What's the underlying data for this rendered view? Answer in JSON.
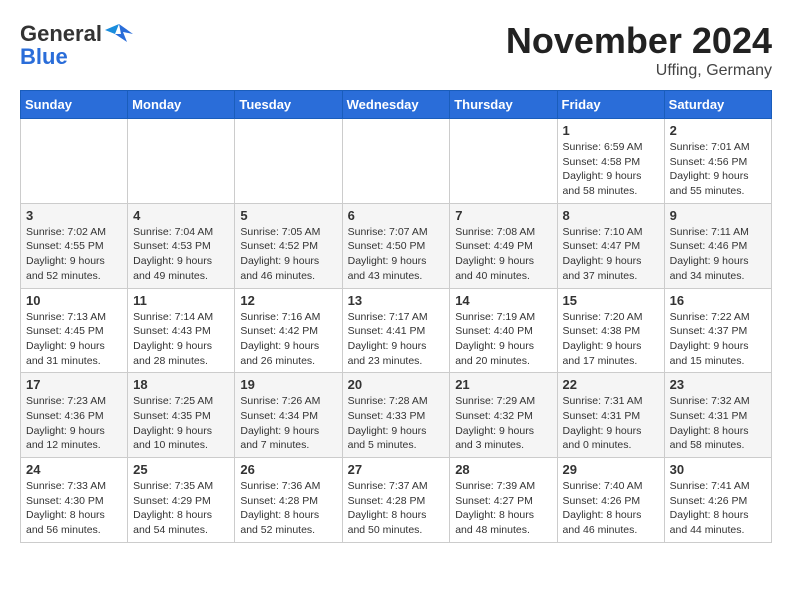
{
  "header": {
    "logo_general": "General",
    "logo_blue": "Blue",
    "month_title": "November 2024",
    "location": "Uffing, Germany"
  },
  "days_of_week": [
    "Sunday",
    "Monday",
    "Tuesday",
    "Wednesday",
    "Thursday",
    "Friday",
    "Saturday"
  ],
  "weeks": [
    [
      {
        "day": "",
        "detail": ""
      },
      {
        "day": "",
        "detail": ""
      },
      {
        "day": "",
        "detail": ""
      },
      {
        "day": "",
        "detail": ""
      },
      {
        "day": "",
        "detail": ""
      },
      {
        "day": "1",
        "detail": "Sunrise: 6:59 AM\nSunset: 4:58 PM\nDaylight: 9 hours\nand 58 minutes."
      },
      {
        "day": "2",
        "detail": "Sunrise: 7:01 AM\nSunset: 4:56 PM\nDaylight: 9 hours\nand 55 minutes."
      }
    ],
    [
      {
        "day": "3",
        "detail": "Sunrise: 7:02 AM\nSunset: 4:55 PM\nDaylight: 9 hours\nand 52 minutes."
      },
      {
        "day": "4",
        "detail": "Sunrise: 7:04 AM\nSunset: 4:53 PM\nDaylight: 9 hours\nand 49 minutes."
      },
      {
        "day": "5",
        "detail": "Sunrise: 7:05 AM\nSunset: 4:52 PM\nDaylight: 9 hours\nand 46 minutes."
      },
      {
        "day": "6",
        "detail": "Sunrise: 7:07 AM\nSunset: 4:50 PM\nDaylight: 9 hours\nand 43 minutes."
      },
      {
        "day": "7",
        "detail": "Sunrise: 7:08 AM\nSunset: 4:49 PM\nDaylight: 9 hours\nand 40 minutes."
      },
      {
        "day": "8",
        "detail": "Sunrise: 7:10 AM\nSunset: 4:47 PM\nDaylight: 9 hours\nand 37 minutes."
      },
      {
        "day": "9",
        "detail": "Sunrise: 7:11 AM\nSunset: 4:46 PM\nDaylight: 9 hours\nand 34 minutes."
      }
    ],
    [
      {
        "day": "10",
        "detail": "Sunrise: 7:13 AM\nSunset: 4:45 PM\nDaylight: 9 hours\nand 31 minutes."
      },
      {
        "day": "11",
        "detail": "Sunrise: 7:14 AM\nSunset: 4:43 PM\nDaylight: 9 hours\nand 28 minutes."
      },
      {
        "day": "12",
        "detail": "Sunrise: 7:16 AM\nSunset: 4:42 PM\nDaylight: 9 hours\nand 26 minutes."
      },
      {
        "day": "13",
        "detail": "Sunrise: 7:17 AM\nSunset: 4:41 PM\nDaylight: 9 hours\nand 23 minutes."
      },
      {
        "day": "14",
        "detail": "Sunrise: 7:19 AM\nSunset: 4:40 PM\nDaylight: 9 hours\nand 20 minutes."
      },
      {
        "day": "15",
        "detail": "Sunrise: 7:20 AM\nSunset: 4:38 PM\nDaylight: 9 hours\nand 17 minutes."
      },
      {
        "day": "16",
        "detail": "Sunrise: 7:22 AM\nSunset: 4:37 PM\nDaylight: 9 hours\nand 15 minutes."
      }
    ],
    [
      {
        "day": "17",
        "detail": "Sunrise: 7:23 AM\nSunset: 4:36 PM\nDaylight: 9 hours\nand 12 minutes."
      },
      {
        "day": "18",
        "detail": "Sunrise: 7:25 AM\nSunset: 4:35 PM\nDaylight: 9 hours\nand 10 minutes."
      },
      {
        "day": "19",
        "detail": "Sunrise: 7:26 AM\nSunset: 4:34 PM\nDaylight: 9 hours\nand 7 minutes."
      },
      {
        "day": "20",
        "detail": "Sunrise: 7:28 AM\nSunset: 4:33 PM\nDaylight: 9 hours\nand 5 minutes."
      },
      {
        "day": "21",
        "detail": "Sunrise: 7:29 AM\nSunset: 4:32 PM\nDaylight: 9 hours\nand 3 minutes."
      },
      {
        "day": "22",
        "detail": "Sunrise: 7:31 AM\nSunset: 4:31 PM\nDaylight: 9 hours\nand 0 minutes."
      },
      {
        "day": "23",
        "detail": "Sunrise: 7:32 AM\nSunset: 4:31 PM\nDaylight: 8 hours\nand 58 minutes."
      }
    ],
    [
      {
        "day": "24",
        "detail": "Sunrise: 7:33 AM\nSunset: 4:30 PM\nDaylight: 8 hours\nand 56 minutes."
      },
      {
        "day": "25",
        "detail": "Sunrise: 7:35 AM\nSunset: 4:29 PM\nDaylight: 8 hours\nand 54 minutes."
      },
      {
        "day": "26",
        "detail": "Sunrise: 7:36 AM\nSunset: 4:28 PM\nDaylight: 8 hours\nand 52 minutes."
      },
      {
        "day": "27",
        "detail": "Sunrise: 7:37 AM\nSunset: 4:28 PM\nDaylight: 8 hours\nand 50 minutes."
      },
      {
        "day": "28",
        "detail": "Sunrise: 7:39 AM\nSunset: 4:27 PM\nDaylight: 8 hours\nand 48 minutes."
      },
      {
        "day": "29",
        "detail": "Sunrise: 7:40 AM\nSunset: 4:26 PM\nDaylight: 8 hours\nand 46 minutes."
      },
      {
        "day": "30",
        "detail": "Sunrise: 7:41 AM\nSunset: 4:26 PM\nDaylight: 8 hours\nand 44 minutes."
      }
    ]
  ]
}
